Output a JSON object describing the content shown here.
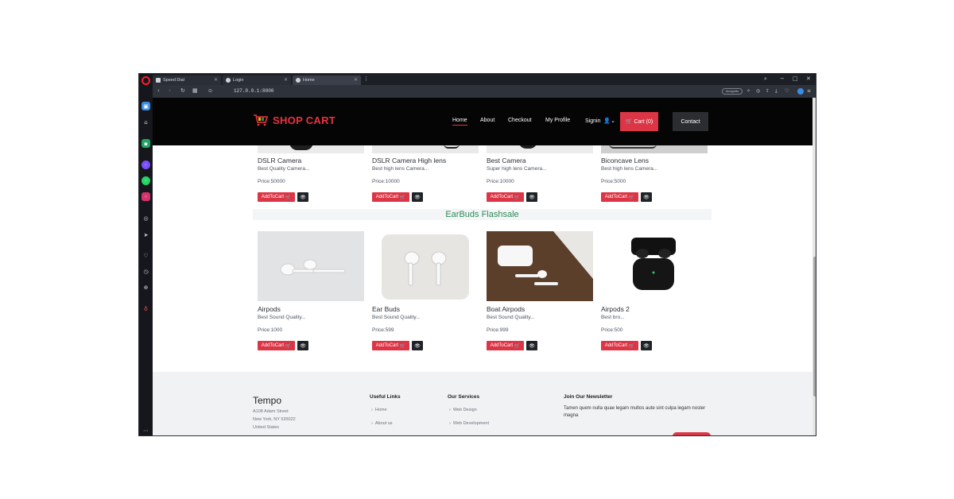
{
  "browser": {
    "tabs": [
      {
        "label": "Speed Dial",
        "active": false
      },
      {
        "label": "Login",
        "active": false
      },
      {
        "label": "Home",
        "active": true
      }
    ],
    "url": "127.0.0.1:8000",
    "incognito_label": "Incognito"
  },
  "site": {
    "brand": "SHOP CART",
    "nav": {
      "home": "Home",
      "about": "About",
      "checkout": "Checkout",
      "profile": "My Profile",
      "signin": "Signin",
      "cart": "Cart (0)",
      "contact": "Contact"
    },
    "cameras": [
      {
        "name": "DSLR Camera",
        "desc": "Best Quality Camera...",
        "price": "Price:50000",
        "add": "AddToCart"
      },
      {
        "name": "DSLR Camera High lens",
        "desc": "Best high lens Camera...",
        "price": "Price:10000",
        "add": "AddToCart"
      },
      {
        "name": "Best Camera",
        "desc": "Super high lens Camera...",
        "price": "Price:10000",
        "add": "AddToCart"
      },
      {
        "name": "Biconcave Lens",
        "desc": "Best high lens Camera...",
        "price": "Price:5000",
        "add": "AddToCart"
      }
    ],
    "section_title": "EarBuds Flashsale",
    "earbuds": [
      {
        "name": "Airpods",
        "desc": "Best Sound Quality...",
        "price": "Price:1000",
        "add": "AddToCart"
      },
      {
        "name": "Ear Buds",
        "desc": "Best Sound Quality...",
        "price": "Price:599",
        "add": "AddToCart"
      },
      {
        "name": "Boat Airpods",
        "desc": "Best Sound Quality...",
        "price": "Price:999",
        "add": "AddToCart"
      },
      {
        "name": "Airpods 2",
        "desc": "Best bro...",
        "price": "Price:500",
        "add": "AddToCart"
      }
    ],
    "footer": {
      "company": "Tempo",
      "address1": "A108 Adam Street",
      "address2": "New York, NY 535022",
      "address3": "United States",
      "useful_links_title": "Useful Links",
      "useful_links": [
        "Home",
        "About us"
      ],
      "services_title": "Our Services",
      "services": [
        "Web Design",
        "Web Development"
      ],
      "newsletter_title": "Join Our Newsletter",
      "newsletter_text": "Tamen quem nulla quae legam multos aute sint culpa legam noster magna"
    }
  },
  "colors": {
    "brand_red": "#dc3545",
    "nav_bg": "#050505",
    "section_green": "#2e8b57"
  }
}
